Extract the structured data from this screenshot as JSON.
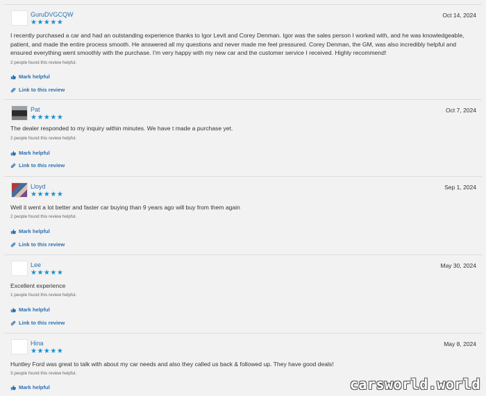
{
  "reviews": [
    {
      "author": "GuruDVGCQW",
      "stars": "★★★★★",
      "date": "Oct 14, 2024",
      "text": "I recently purchased a car and had an outstanding experience thanks to Igor Levit and Corey Denman. Igor was the sales person I worked with, and he was knowledgeable, patient, and made the entire process smooth. He answered all my questions and never made me feel pressured. Corey Denman, the GM, was also incredibly helpful and ensured everything went smoothly with the purchase. I'm very happy with my new car and the customer service I received. Highly recommend!",
      "helpful_count": "2 people found this review helpful.",
      "mark_helpful": "Mark helpful",
      "link": "Link to this review"
    },
    {
      "author": "Pat",
      "stars": "★★★★★",
      "date": "Oct 7, 2024",
      "text": "The dealer responded to my inquiry within minutes. We have t made a purchase yet.",
      "helpful_count": "2 people found this review helpful.",
      "mark_helpful": "Mark helpful",
      "link": "Link to this review"
    },
    {
      "author": "Lloyd",
      "stars": "★★★★★",
      "date": "Sep 1, 2024",
      "text": "Well it went a lot better and faster car buying than 9 years ago will buy from them again",
      "helpful_count": "2 people found this review helpful.",
      "mark_helpful": "Mark helpful",
      "link": "Link to this review"
    },
    {
      "author": "Lee",
      "stars": "★★★★★",
      "date": "May 30, 2024",
      "text": "Excellent experience",
      "helpful_count": "1 people found this review helpful.",
      "mark_helpful": "Mark helpful",
      "link": "Link to this review"
    },
    {
      "author": "Hina",
      "stars": "★★★★★",
      "date": "May 8, 2024",
      "text": "Huntley Ford was great to talk with about my car needs and also they called us back & followed up. They have good deals!",
      "helpful_count": "3 people found this review helpful.",
      "mark_helpful": "Mark helpful"
    }
  ],
  "watermark": "carsworld.world",
  "colors": {
    "accent": "#2c6fb0",
    "stars": "#1a8fd1",
    "background": "#f2f2f2"
  },
  "icons": {
    "helpful": "thumbs-up-icon",
    "link": "link-icon"
  }
}
